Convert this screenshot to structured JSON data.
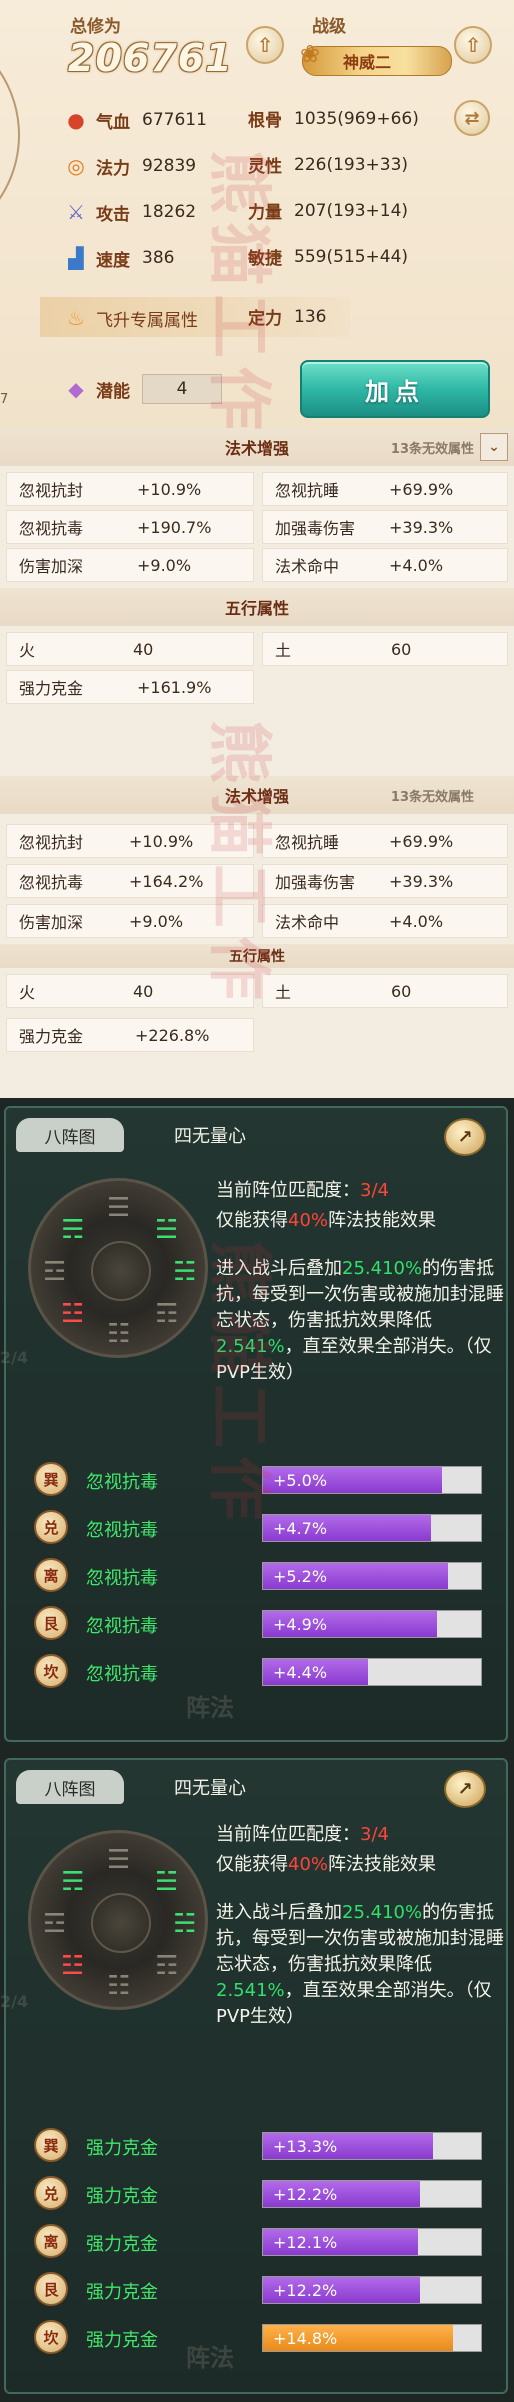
{
  "stats": {
    "total_label": "总修为",
    "total_value": "206761",
    "title_label": "战级",
    "title_badge": "神威二",
    "side_number": "7",
    "rows": [
      {
        "icon": "blood-drop-icon",
        "label": "气血",
        "value": "677611",
        "label2": "根骨",
        "value2": "1035(969+66)"
      },
      {
        "icon": "mana-swirl-icon",
        "label": "法力",
        "value": "92839",
        "label2": "灵性",
        "value2": "226(193+33)"
      },
      {
        "icon": "sword-icon",
        "label": "攻击",
        "value": "18262",
        "label2": "力量",
        "value2": "207(193+14)"
      },
      {
        "icon": "boot-icon",
        "label": "速度",
        "value": "386",
        "label2": "敏捷",
        "value2": "559(515+44)"
      },
      {
        "icon": "flame-icon",
        "label": "飞升专属属性",
        "value": "",
        "label2": "定力",
        "value2": "136"
      }
    ],
    "potential_label": "潜能",
    "potential_value": "4",
    "add_points_label": "加点"
  },
  "panel1": {
    "magic_header": "法术增强",
    "magic_note": "13条无效属性",
    "magic": [
      {
        "k": "忽视抗封",
        "v": "+10.9%"
      },
      {
        "k": "忽视抗睡",
        "v": "+69.9%"
      },
      {
        "k": "忽视抗毒",
        "v": "+190.7%"
      },
      {
        "k": "加强毒伤害",
        "v": "+39.3%"
      },
      {
        "k": "伤害加深",
        "v": "+9.0%"
      },
      {
        "k": "法术命中",
        "v": "+4.0%"
      }
    ],
    "five_header": "五行属性",
    "five": [
      {
        "k": "火",
        "v": "40"
      },
      {
        "k": "土",
        "v": "60"
      },
      {
        "k": "强力克金",
        "v": "+161.9%"
      }
    ]
  },
  "panel2": {
    "magic_header": "法术增强",
    "magic_note": "13条无效属性",
    "magic": [
      {
        "k": "忽视抗封",
        "v": "+10.9%"
      },
      {
        "k": "忽视抗睡",
        "v": "+69.9%"
      },
      {
        "k": "忽视抗毒",
        "v": "+164.2%"
      },
      {
        "k": "加强毒伤害",
        "v": "+39.3%"
      },
      {
        "k": "伤害加深",
        "v": "+9.0%"
      },
      {
        "k": "法术命中",
        "v": "+4.0%"
      }
    ],
    "five_header": "五行属性",
    "five": [
      {
        "k": "火",
        "v": "40"
      },
      {
        "k": "土",
        "v": "60"
      },
      {
        "k": "强力克金",
        "v": "+226.8%"
      }
    ]
  },
  "formation1": {
    "tab": "八阵图",
    "name": "四无量心",
    "match_label": "当前阵位匹配度：",
    "match_value": "3/4",
    "only_prefix": "仅能获得",
    "only_pct": "40%",
    "only_suffix": "阵法技能效果",
    "desc_a": "进入战斗后叠加",
    "desc_pct1": "25.410%",
    "desc_b": "的伤害抵抗，每受到一次伤害或被施加封混睡忘状态，伤害抵抗效果降低",
    "desc_pct2": "2.541%",
    "desc_c": "，直至效果全部消失。（仅PVP生效）",
    "rows": [
      {
        "seal": "巽",
        "name": "忽视抗毒",
        "text": "+5.0%",
        "fill": 0.82,
        "color": "purple"
      },
      {
        "seal": "兑",
        "name": "忽视抗毒",
        "text": "+4.7%",
        "fill": 0.77,
        "color": "purple"
      },
      {
        "seal": "离",
        "name": "忽视抗毒",
        "text": "+5.2%",
        "fill": 0.85,
        "color": "purple"
      },
      {
        "seal": "艮",
        "name": "忽视抗毒",
        "text": "+4.9%",
        "fill": 0.8,
        "color": "purple"
      },
      {
        "seal": "坎",
        "name": "忽视抗毒",
        "text": "+4.4%",
        "fill": 0.48,
        "color": "purple"
      }
    ]
  },
  "formation2": {
    "tab": "八阵图",
    "name": "四无量心",
    "match_label": "当前阵位匹配度：",
    "match_value": "3/4",
    "only_prefix": "仅能获得",
    "only_pct": "40%",
    "only_suffix": "阵法技能效果",
    "desc_a": "进入战斗后叠加",
    "desc_pct1": "25.410%",
    "desc_b": "的伤害抵抗，每受到一次伤害或被施加封混睡忘状态，伤害抵抗效果降低",
    "desc_pct2": "2.541%",
    "desc_c": "，直至效果全部消失。（仅PVP生效）",
    "rows": [
      {
        "seal": "巽",
        "name": "强力克金",
        "text": "+13.3%",
        "fill": 0.78,
        "color": "purple"
      },
      {
        "seal": "兑",
        "name": "强力克金",
        "text": "+12.2%",
        "fill": 0.72,
        "color": "purple"
      },
      {
        "seal": "离",
        "name": "强力克金",
        "text": "+12.1%",
        "fill": 0.71,
        "color": "purple"
      },
      {
        "seal": "艮",
        "name": "强力克金",
        "text": "+12.2%",
        "fill": 0.72,
        "color": "purple"
      },
      {
        "seal": "坎",
        "name": "强力克金",
        "text": "+14.8%",
        "fill": 0.87,
        "color": "orange"
      }
    ]
  },
  "watermark": "熊猫工作室"
}
